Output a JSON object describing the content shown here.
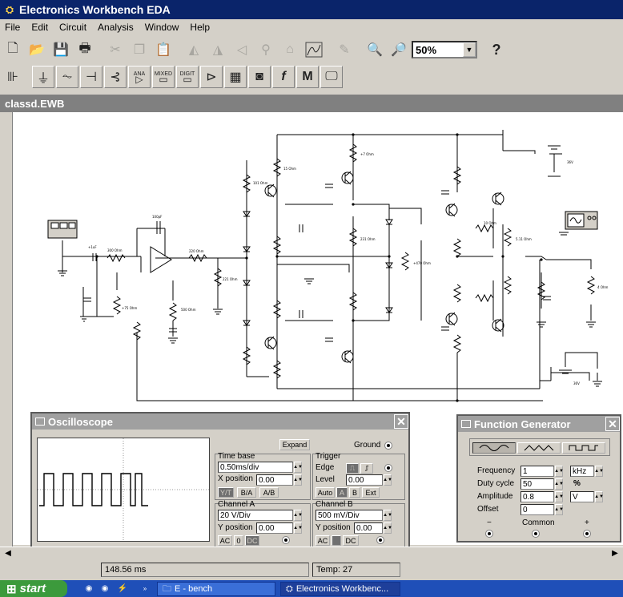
{
  "app": {
    "title": "Electronics Workbench EDA"
  },
  "menu": [
    "File",
    "Edit",
    "Circuit",
    "Analysis",
    "Window",
    "Help"
  ],
  "toolbar": {
    "zoom": "50%",
    "help": "?",
    "mixed_label": "MIXED",
    "ana_label": "ANA",
    "digit_label": "DIGIT",
    "m_label": "M",
    "f_label": "f"
  },
  "document": {
    "title": "classd.EWB"
  },
  "circuit": {
    "labels": {
      "c100pF": "100pF",
      "r300": "300 Ohm",
      "r220": "220 Ohm",
      "r221": "221 Ohm",
      "r1f": "+1uF",
      "r75": "+75 Ohm",
      "r15": "15 Ohm",
      "r101": "101 Ohm",
      "r500": "500 Ohm",
      "r7": "+7 Ohm",
      "r231": "231 Ohm",
      "r470": "+470 Ohm",
      "r10": "10 Ohm",
      "r5": "5.11 Ohm",
      "v36": "36V",
      "r4": "4 Ohm"
    }
  },
  "oscilloscope": {
    "title": "Oscilloscope",
    "expand": "Expand",
    "ground": "Ground",
    "timebase": {
      "label": "Time base",
      "value": "0.50ms/div",
      "xpos_label": "X position",
      "xpos": "0.00",
      "btn_yt": "Y/T",
      "btn_ba": "B/A",
      "btn_ab": "A/B"
    },
    "trigger": {
      "label": "Trigger",
      "edge": "Edge",
      "level_label": "Level",
      "level": "0.00",
      "auto": "Auto",
      "a": "A",
      "b": "B",
      "ext": "Ext"
    },
    "channel_a": {
      "label": "Channel A",
      "value": "20  V/Div",
      "ypos_label": "Y position",
      "ypos": "0.00",
      "ac": "AC",
      "zero": "0",
      "dc": "DC"
    },
    "channel_b": {
      "label": "Channel B",
      "value": "500 mV/Div",
      "ypos_label": "Y position",
      "ypos": "0.00",
      "ac": "AC",
      "dc": "DC"
    }
  },
  "function_generator": {
    "title": "Function Generator",
    "frequency_label": "Frequency",
    "frequency": "1",
    "frequency_unit": "kHz",
    "duty_label": "Duty cycle",
    "duty": "50",
    "duty_unit": "%",
    "amplitude_label": "Amplitude",
    "amplitude": "0.8",
    "amplitude_unit": "V",
    "offset_label": "Offset",
    "offset": "0",
    "minus": "−",
    "common": "Common",
    "plus": "+"
  },
  "status": {
    "time": "148.56 ms",
    "temp": "Temp:  27"
  },
  "taskbar": {
    "start": "start",
    "task1": "E - bench",
    "task2": "Electronics Workbenc..."
  }
}
